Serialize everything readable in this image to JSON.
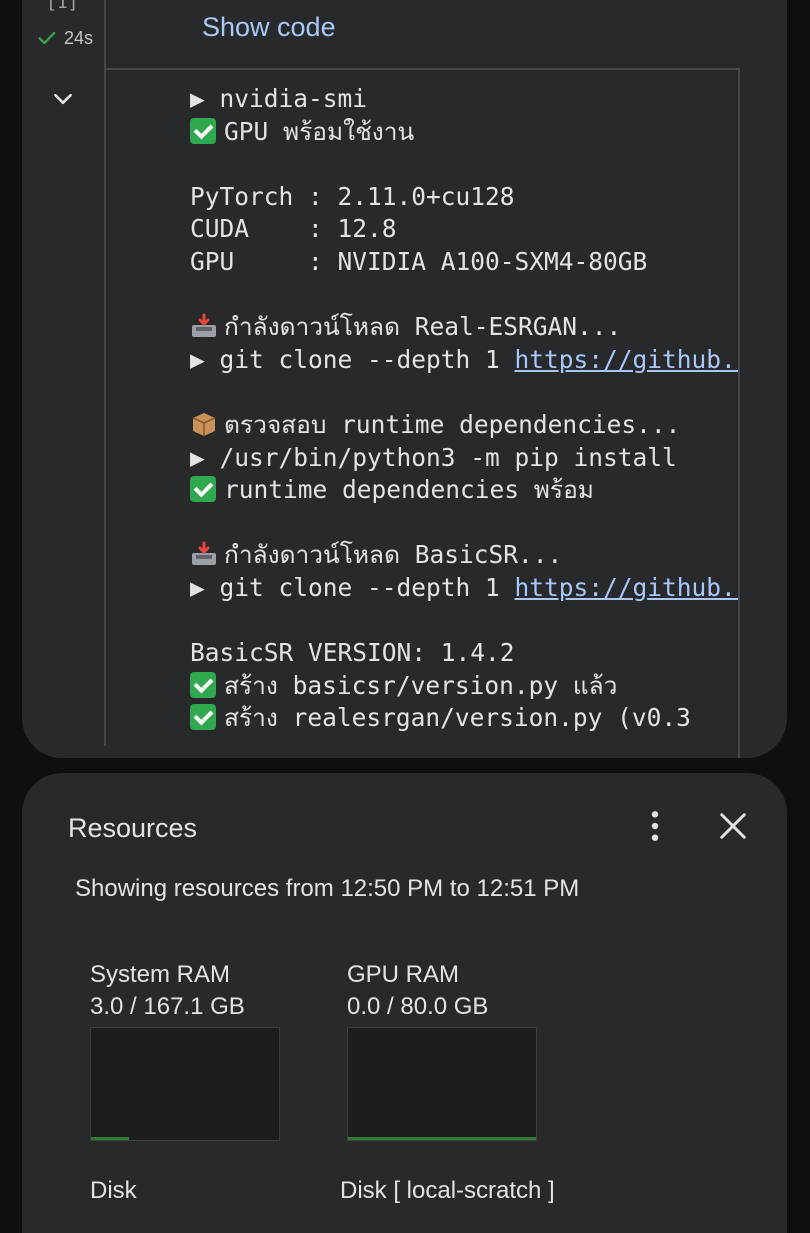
{
  "cell": {
    "execution_count": "[1]",
    "status_time": "24s",
    "show_code_label": "Show code",
    "output_lines": [
      {
        "type": "text",
        "text": "▶ nvidia-smi"
      },
      {
        "type": "check",
        "text": "GPU พร้อมใช้งาน"
      },
      {
        "type": "blank"
      },
      {
        "type": "text",
        "text": "PyTorch : 2.11.0+cu128"
      },
      {
        "type": "text",
        "text": "CUDA    : 12.8"
      },
      {
        "type": "text",
        "text": "GPU     : NVIDIA A100-SXM4-80GB"
      },
      {
        "type": "blank"
      },
      {
        "type": "inbox",
        "text": "กำลังดาวน์โหลด Real-ESRGAN..."
      },
      {
        "type": "link",
        "text": "▶ git clone --depth 1 ",
        "link": "https://github.com/xinntao/Real-ESRGAN"
      },
      {
        "type": "blank"
      },
      {
        "type": "box",
        "text": "ตรวจสอบ runtime dependencies..."
      },
      {
        "type": "text",
        "text": "▶ /usr/bin/python3 -m pip install"
      },
      {
        "type": "check",
        "text": "runtime dependencies พร้อม"
      },
      {
        "type": "blank"
      },
      {
        "type": "inbox",
        "text": "กำลังดาวน์โหลด BasicSR..."
      },
      {
        "type": "link",
        "text": "▶ git clone --depth 1 ",
        "link": "https://github.com/XPixelGroup/BasicSR"
      },
      {
        "type": "blank"
      },
      {
        "type": "text",
        "text": "BasicSR VERSION: 1.4.2"
      },
      {
        "type": "check",
        "text": "สร้าง basicsr/version.py แล้ว"
      },
      {
        "type": "check",
        "text": "สร้าง realesrgan/version.py (v0.3"
      }
    ]
  },
  "resources": {
    "title": "Resources",
    "range_text": "Showing resources from 12:50 PM to 12:51 PM",
    "metrics": [
      {
        "label": "System RAM",
        "value": "3.0 / 167.1 GB",
        "fraction": 0.018
      },
      {
        "label": "GPU RAM",
        "value": "0.0 / 80.0 GB",
        "fraction": 0.0
      }
    ],
    "disk_labels": [
      "Disk",
      "Disk [ local-scratch ]"
    ]
  },
  "colors": {
    "accent_link": "#a8c7fa",
    "success": "#34a853",
    "graph_line": "#2e7d32"
  },
  "icons": [
    "check-icon",
    "chevron-down-icon",
    "more-vert-icon",
    "close-icon"
  ]
}
